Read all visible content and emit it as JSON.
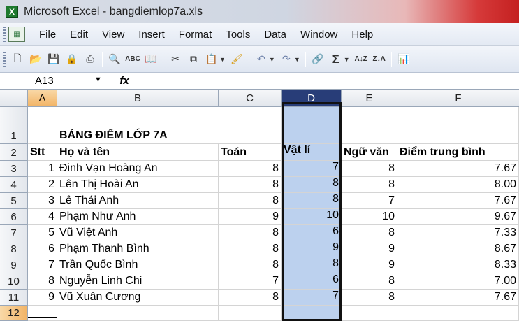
{
  "window": {
    "app_icon": "X",
    "title": "Microsoft Excel - bangdiemlop7a.xls"
  },
  "menu": [
    "File",
    "Edit",
    "View",
    "Insert",
    "Format",
    "Tools",
    "Data",
    "Window",
    "Help"
  ],
  "toolbar_icons": [
    "new-icon",
    "open-icon",
    "save-icon",
    "permission-icon",
    "print-icon",
    "print-preview-icon",
    "spelling-icon",
    "research-icon",
    "cut-icon",
    "copy-icon",
    "paste-icon",
    "format-painter-icon",
    "undo-icon",
    "redo-icon",
    "hyperlink-icon",
    "autosum-icon",
    "sort-ascending-icon",
    "sort-descending-icon",
    "chart-wizard-icon"
  ],
  "formula_bar": {
    "name_box": "A13",
    "fx": "fx",
    "formula": ""
  },
  "columns": [
    "A",
    "B",
    "C",
    "D",
    "E",
    "F"
  ],
  "rows": [
    {
      "n": "1",
      "cells": [
        "",
        "BẢNG ĐIỂM LỚP 7A",
        "",
        "",
        "",
        ""
      ]
    },
    {
      "n": "2",
      "cells": [
        "Stt",
        "Họ và tên",
        "Toán",
        "Vật lí",
        "Ngữ văn",
        "Điểm trung bình"
      ]
    },
    {
      "n": "3",
      "cells": [
        "1",
        "Đinh Vạn Hoàng An",
        "8",
        "7",
        "8",
        "7.67"
      ]
    },
    {
      "n": "4",
      "cells": [
        "2",
        "Lên Thị Hoài An",
        "8",
        "8",
        "8",
        "8.00"
      ]
    },
    {
      "n": "5",
      "cells": [
        "3",
        "Lê Thái Anh",
        "8",
        "8",
        "7",
        "7.67"
      ]
    },
    {
      "n": "6",
      "cells": [
        "4",
        "Phạm Như Anh",
        "9",
        "10",
        "10",
        "9.67"
      ]
    },
    {
      "n": "7",
      "cells": [
        "5",
        "Vũ Việt Anh",
        "8",
        "6",
        "8",
        "7.33"
      ]
    },
    {
      "n": "8",
      "cells": [
        "6",
        "Phạm Thanh Bình",
        "8",
        "9",
        "9",
        "8.67"
      ]
    },
    {
      "n": "9",
      "cells": [
        "7",
        "Trần Quốc Bình",
        "8",
        "8",
        "9",
        "8.33"
      ]
    },
    {
      "n": "10",
      "cells": [
        "8",
        "Nguyễn Linh Chi",
        "7",
        "6",
        "8",
        "7.00"
      ]
    },
    {
      "n": "11",
      "cells": [
        "9",
        "Vũ Xuân Cương",
        "8",
        "7",
        "8",
        "7.67"
      ]
    },
    {
      "n": "12",
      "cells": [
        "",
        "",
        "",
        "",
        "",
        ""
      ]
    }
  ],
  "colors": {
    "selection": "#bcd1ee",
    "active_header": "#283d78",
    "header_highlight": "#f2b466"
  }
}
